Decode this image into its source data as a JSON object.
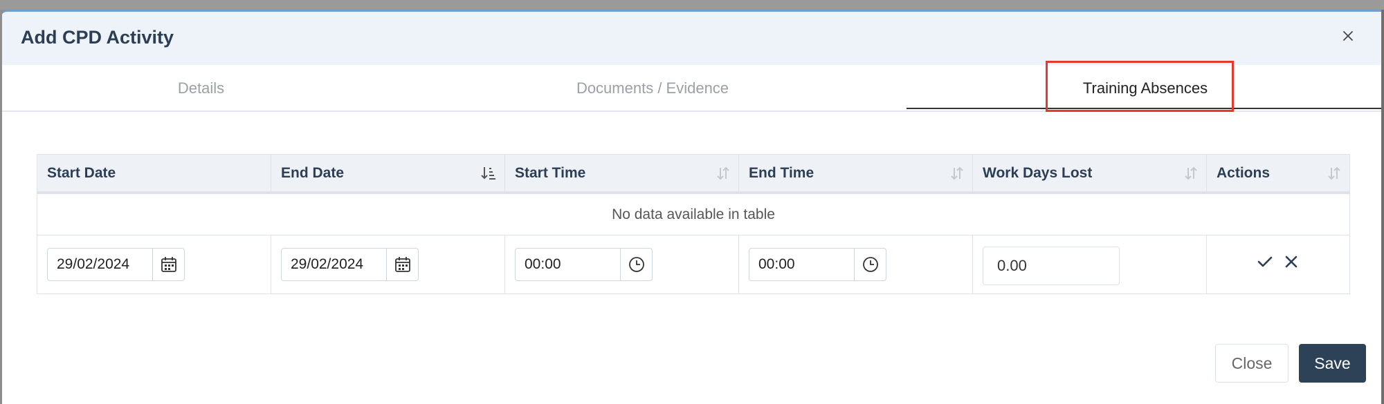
{
  "modal": {
    "title": "Add CPD Activity",
    "close_icon": "close-icon"
  },
  "tabs": [
    {
      "label": "Details",
      "active": false
    },
    {
      "label": "Documents / Evidence",
      "active": false
    },
    {
      "label": "Training Absences",
      "active": true
    }
  ],
  "table": {
    "columns": [
      "Start Date",
      "End Date",
      "Start Time",
      "End Time",
      "Work Days Lost",
      "Actions"
    ],
    "empty_message": "No data available in table",
    "edit_row": {
      "start_date": "29/02/2024",
      "end_date": "29/02/2024",
      "start_time": "00:00",
      "end_time": "00:00",
      "work_days_lost": "0.00"
    }
  },
  "footer": {
    "close_label": "Close",
    "save_label": "Save"
  },
  "colors": {
    "title": "#2c3e54",
    "save_bg": "#2e4257",
    "highlight": "#e5392b"
  }
}
